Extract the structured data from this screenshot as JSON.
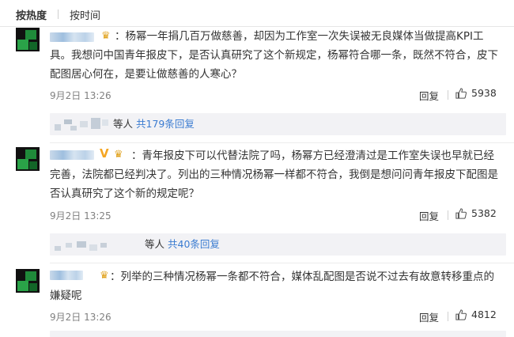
{
  "tabs": [
    {
      "label": "按热度",
      "active": true
    },
    {
      "label": "按时间",
      "active": false
    }
  ],
  "comments": [
    {
      "text_line1": "：杨幂一年捐几百万做慈善，却因为工作室一次失误被无良媒体当做提高KPI工具。",
      "text_rest": "我想问中国青年报皮下，是否认真研究了这个新规定，杨幂符合哪一条，既然不符合，皮下配图居心何在，是要让做慈善的人寒心？",
      "date": "9月2日 13:26",
      "reply_label": "回复",
      "likes": "5938",
      "sub_replies": {
        "who": "等人",
        "count_text": "共179条回复"
      }
    },
    {
      "text_line1": "：青年报皮下可以代替法院了吗，杨幂方已经澄清过是工作室失误也早就已经完",
      "text_rest": "善，法院都已经判决了。列出的三种情况杨幂一样都不符合，我倒是想问问青年报皮下配图是否认真研究了这个新的规定呢？",
      "date": "9月2日 13:25",
      "reply_label": "回复",
      "likes": "5382",
      "sub_replies": {
        "who": "等人",
        "count_text": "共40条回复"
      }
    },
    {
      "text_line1": "：列举的三种情况杨幂一条都不符合，媒体乱配图是否说不过去有故意转移重点的嫌",
      "text_rest": "疑呢",
      "date": "9月2日 13:26",
      "reply_label": "回复",
      "likes": "4812"
    }
  ],
  "colors": {
    "link_blue": "#3b7cd1",
    "meta_gray": "#808080",
    "badge_gold": "#f5a623"
  },
  "icons": {
    "like": "thumbs-up-icon",
    "verified": "verified-v-icon",
    "member": "crown-icon"
  }
}
